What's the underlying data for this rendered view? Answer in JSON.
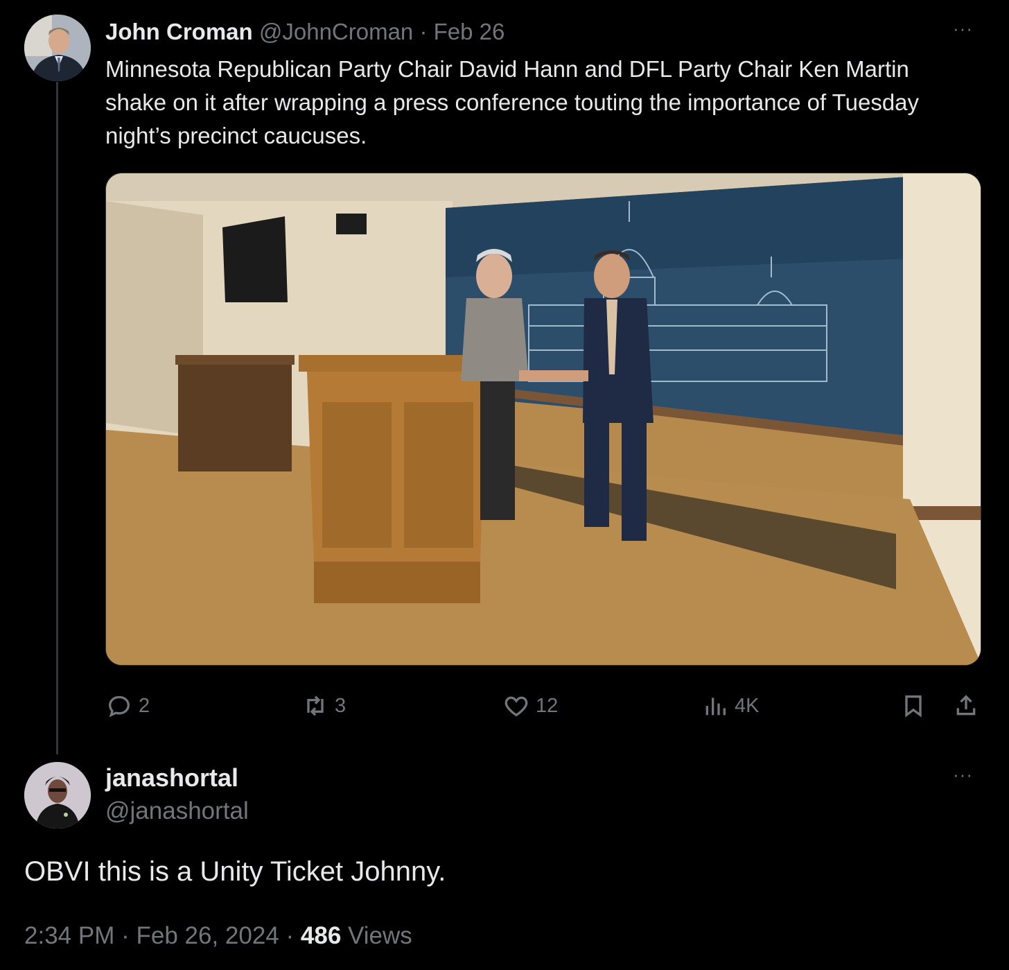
{
  "post1": {
    "name": "John Croman",
    "handle": "@JohnCroman",
    "separator": "·",
    "date": "Feb 26",
    "text": "Minnesota Republican Party Chair David Hann and DFL Party Chair Ken Martin shake on it after wrapping a press conference touting the importance of Tuesday night’s precinct caucuses.",
    "more": "···",
    "actions": {
      "replies": "2",
      "reposts": "3",
      "likes": "12",
      "views": "4K"
    },
    "icons": [
      "reply-icon",
      "repost-icon",
      "like-icon",
      "views-icon",
      "bookmark-icon",
      "share-icon"
    ]
  },
  "post2": {
    "name": "janashortal",
    "handle": "@janashortal",
    "more": "···",
    "text": "OBVI this is a Unity Ticket Johnny.",
    "time": "2:34 PM",
    "separator": "·",
    "date": "Feb 26, 2024",
    "views_count": "486",
    "views_label": "Views"
  },
  "colors": {
    "background": "#000000",
    "text": "#e7e9ea",
    "muted": "#71767b",
    "thread_line": "#333639"
  }
}
